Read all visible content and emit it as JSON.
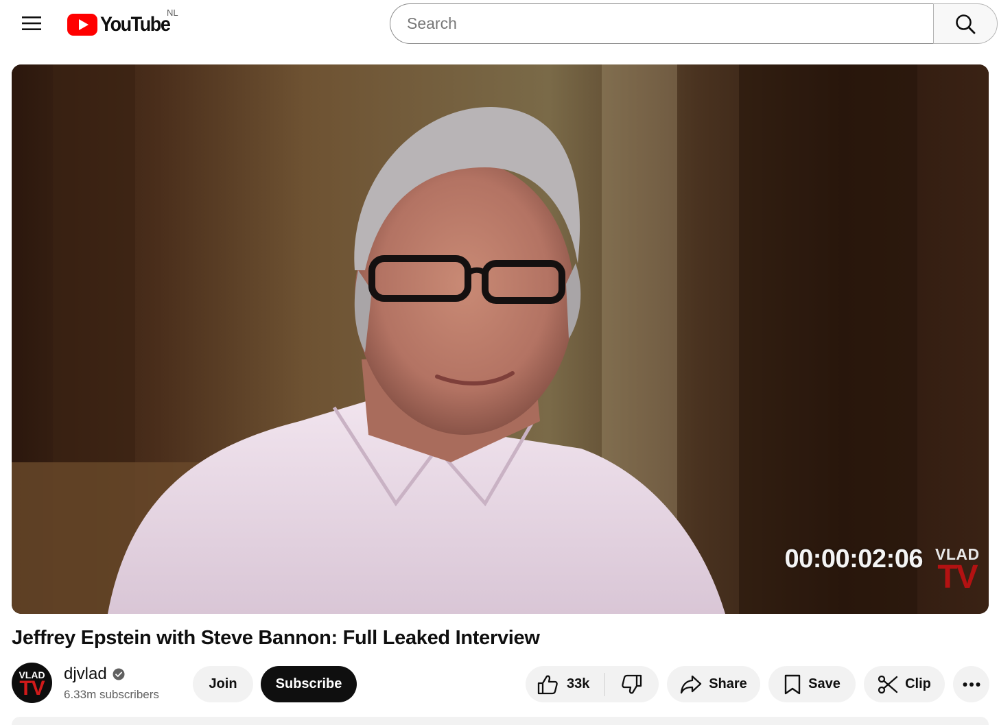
{
  "header": {
    "menu_icon": "hamburger-menu-icon",
    "logo_text": "YouTube",
    "region_code": "NL",
    "search_placeholder": "Search",
    "search_icon": "search-icon"
  },
  "video": {
    "timecode_overlay": "00:00:02:06",
    "watermark_top": "VLAD",
    "watermark_bottom": "TV",
    "title": "Jeffrey Epstein with Steve Bannon: Full Leaked Interview"
  },
  "channel": {
    "avatar_top": "VLAD",
    "avatar_bottom": "TV",
    "name": "djvlad",
    "verified_icon": "verified-check-icon",
    "subscribers": "6.33m subscribers",
    "join_label": "Join",
    "subscribe_label": "Subscribe"
  },
  "actions": {
    "like_count": "33k",
    "like_icon": "thumbs-up-icon",
    "dislike_icon": "thumbs-down-icon",
    "share_label": "Share",
    "share_icon": "share-arrow-icon",
    "save_label": "Save",
    "save_icon": "bookmark-icon",
    "clip_label": "Clip",
    "clip_icon": "scissors-icon",
    "more_icon": "more-horizontal-icon"
  },
  "colors": {
    "brand_red": "#ff0000",
    "text_primary": "#0f0f0f",
    "text_secondary": "#606060",
    "pill_background": "#f2f2f2",
    "watermark_red": "#b31212"
  }
}
